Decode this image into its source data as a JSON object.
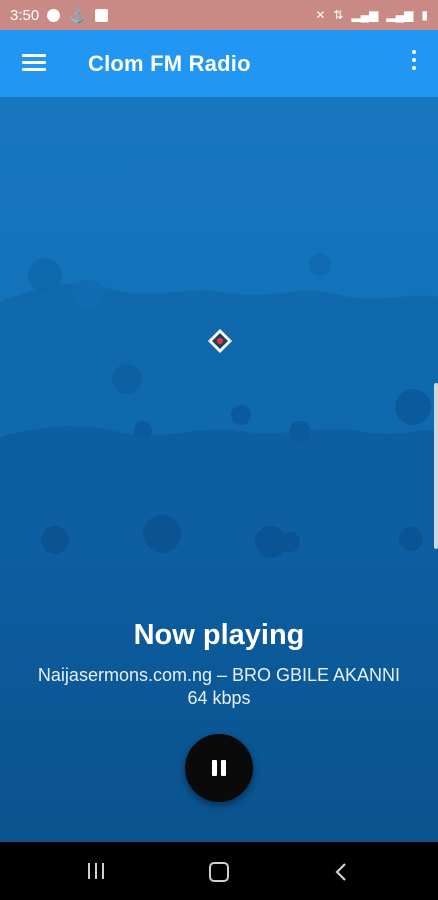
{
  "status_bar": {
    "time": "3:50",
    "left_icons": [
      "play-circle-icon",
      "usb-icon",
      "message-icon"
    ],
    "right_icons": [
      "mute-icon",
      "data-icon",
      "signal-icon",
      "signal-icon",
      "battery-icon"
    ]
  },
  "app_bar": {
    "title": "Clom FM Radio",
    "background": "#2196f3"
  },
  "hero": {
    "logo_icon": "station-logo-icon"
  },
  "player": {
    "heading": "Now playing",
    "track": "Naijasermons.com.ng – BRO GBILE AKANNI",
    "bitrate": "64 kbps",
    "control_icon": "pause-icon"
  },
  "nav_bar": {
    "buttons": [
      "recent-apps-icon",
      "home-icon",
      "back-icon"
    ]
  },
  "colors": {
    "status_bar": "#c98a85",
    "accent": "#2196f3",
    "hero": "#1272ba",
    "panel": "#0b5a99"
  }
}
